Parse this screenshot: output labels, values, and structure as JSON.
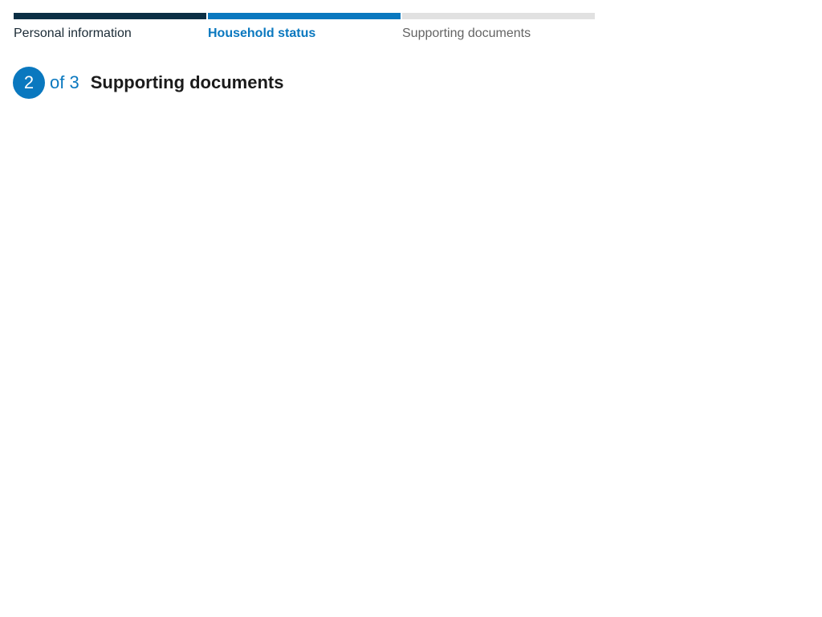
{
  "progress": {
    "steps": [
      {
        "label": "Personal information",
        "status": "completed"
      },
      {
        "label": "Household status",
        "status": "current"
      },
      {
        "label": "Supporting documents",
        "status": "upcoming"
      }
    ]
  },
  "indicator": {
    "current_number": "2",
    "total_text": "of 3",
    "title": "Supporting documents"
  },
  "colors": {
    "completed": "#0b2f45",
    "current": "#0a78bf",
    "upcoming": "#e1e1e1"
  }
}
